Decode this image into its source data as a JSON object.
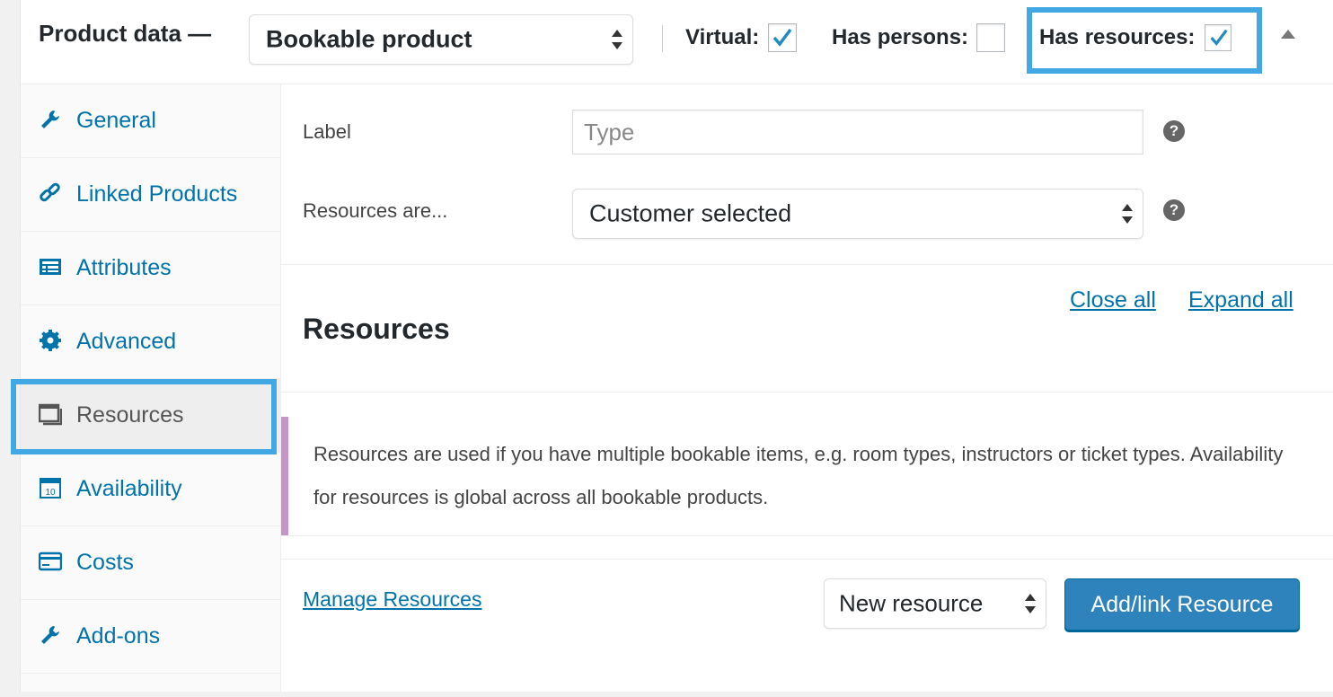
{
  "header": {
    "title": "Product data —",
    "product_type": "Bookable product",
    "virtual_label": "Virtual:",
    "virtual_checked": true,
    "has_persons_label": "Has persons:",
    "has_persons_checked": false,
    "has_resources_label": "Has resources:",
    "has_resources_checked": true
  },
  "sidebar": {
    "items": [
      {
        "label": "General",
        "icon": "wrench-icon"
      },
      {
        "label": "Linked Products",
        "icon": "link-icon"
      },
      {
        "label": "Attributes",
        "icon": "list-card-icon"
      },
      {
        "label": "Advanced",
        "icon": "gear-icon"
      },
      {
        "label": "Resources",
        "icon": "window-icon",
        "active": true
      },
      {
        "label": "Availability",
        "icon": "calendar-icon"
      },
      {
        "label": "Costs",
        "icon": "credit-card-icon"
      },
      {
        "label": "Add-ons",
        "icon": "wrench-icon"
      }
    ]
  },
  "main": {
    "label_field": {
      "label": "Label",
      "placeholder": "Type",
      "value": ""
    },
    "resources_are": {
      "label": "Resources are...",
      "value": "Customer selected"
    },
    "help_glyph": "?",
    "section_title": "Resources",
    "close_all": "Close all",
    "expand_all": "Expand all",
    "notice": "Resources are used if you have multiple bookable items, e.g. room types, instructors or ticket types. Availability for resources is global across all bookable products.",
    "manage_resources": "Manage Resources",
    "new_resource_select": "New resource",
    "add_button": "Add/link Resource"
  },
  "colors": {
    "link": "#0073aa",
    "highlight": "#41a8e3",
    "primary_button": "#2e83bd",
    "notice_border": "#c595c8"
  }
}
